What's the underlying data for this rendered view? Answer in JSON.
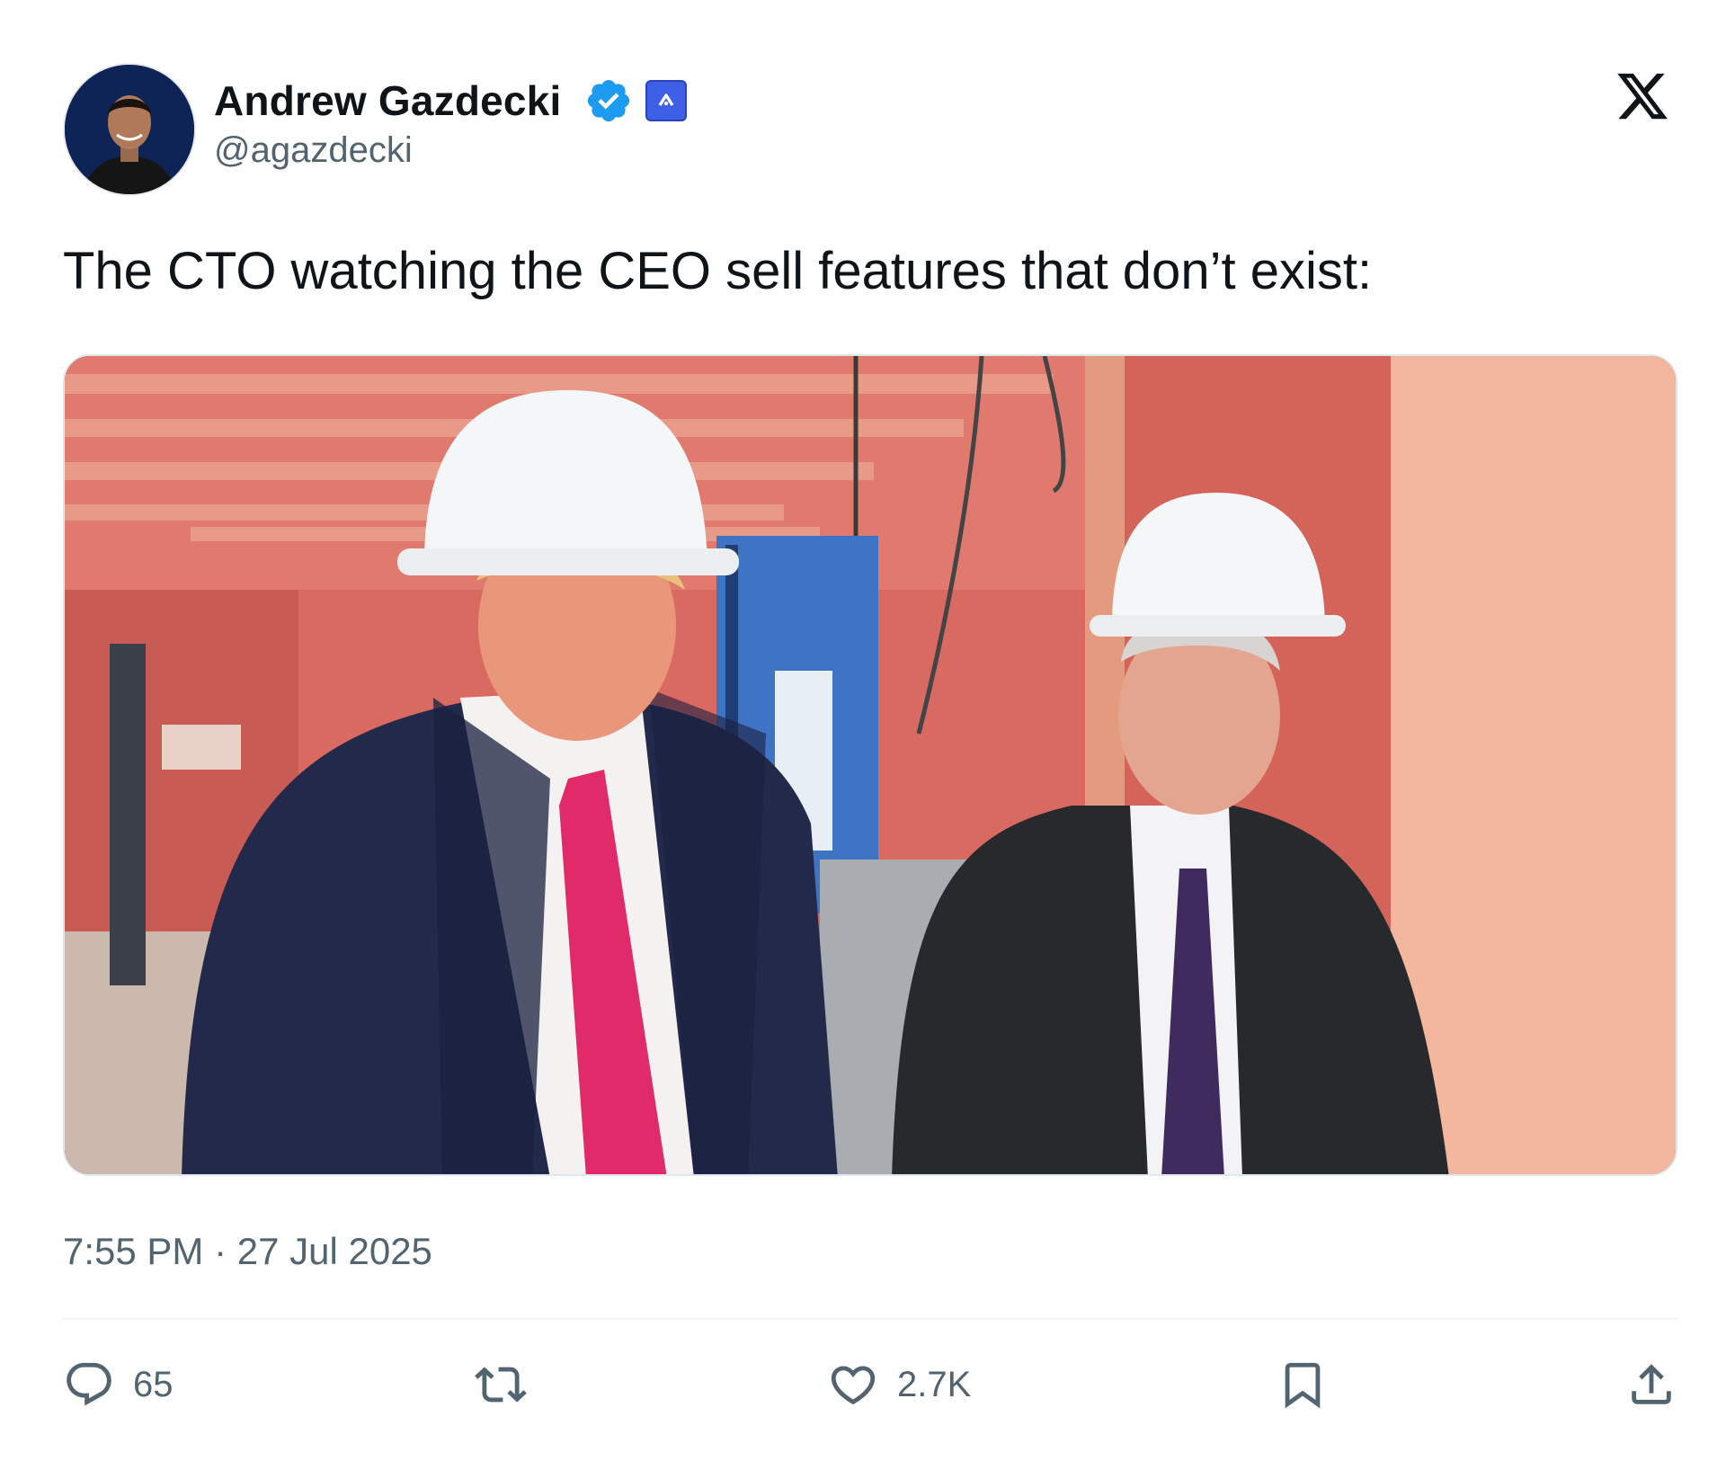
{
  "author": {
    "display_name": "Andrew Gazdecki",
    "handle": "@agazdecki",
    "verified_icon": "verified-badge-icon",
    "affiliation_icon": "affiliation-badge-icon",
    "avatar": "profile-photo"
  },
  "platform": {
    "logo_icon": "x-logo-icon"
  },
  "tweet": {
    "text": "The CTO watching the CEO sell features that don’t exist:",
    "media_description": "photo-two-men-in-hard-hats",
    "timestamp": "7:55 PM · 27 Jul 2025"
  },
  "actions": {
    "reply": {
      "icon": "reply-icon",
      "count": "65"
    },
    "retweet": {
      "icon": "retweet-icon",
      "count": ""
    },
    "like": {
      "icon": "heart-icon",
      "count": "2.7K"
    },
    "bookmark": {
      "icon": "bookmark-icon"
    },
    "share": {
      "icon": "share-icon"
    }
  },
  "colors": {
    "text_primary": "#0f1419",
    "text_secondary": "#536471",
    "verified_blue": "#1d9bf0",
    "affiliation_blue": "#3d5fe6",
    "divider": "#eff3f4"
  }
}
